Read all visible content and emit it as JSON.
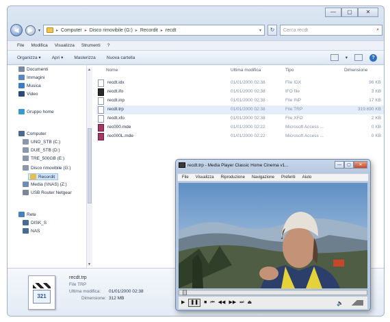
{
  "window": {
    "caps": {
      "min": "—",
      "max": "▢",
      "close": "✕"
    }
  },
  "address": {
    "crumbs": [
      "Computer",
      "Disco rimovibile (G:)",
      "Recordit",
      "recdt"
    ],
    "search_placeholder": "Cerca recdt"
  },
  "menu": [
    "File",
    "Modifica",
    "Visualizza",
    "Strumenti",
    "?"
  ],
  "toolbar": {
    "organize": "Organizza ▾",
    "open": "Apri ▾",
    "burn": "Masterizza",
    "new_folder": "Nuova cartella"
  },
  "nav": {
    "items": [
      {
        "label": "Documenti",
        "icon": "documents-icon",
        "color": "#7a8aa0"
      },
      {
        "label": "Immagini",
        "icon": "pictures-icon",
        "color": "#5b86c0"
      },
      {
        "label": "Musica",
        "icon": "music-icon",
        "color": "#3b7bc8"
      },
      {
        "label": "Video",
        "icon": "video-icon",
        "color": "#2a4a7a"
      },
      {
        "label": "Gruppo home",
        "icon": "homegroup-icon",
        "color": "#3a9ad0"
      },
      {
        "label": "Computer",
        "icon": "computer-icon",
        "color": "#4a6a96"
      },
      {
        "label": "UNO_STB (C:)",
        "icon": "drive-icon",
        "color": "#8a98aa"
      },
      {
        "label": "DUE_STB (D:)",
        "icon": "drive-icon",
        "color": "#8a98aa"
      },
      {
        "label": "TRE_500GB (E:)",
        "icon": "drive-icon",
        "color": "#8a98aa"
      },
      {
        "label": "Disco rimovibile (G:)",
        "icon": "usb-drive-icon",
        "color": "#8a98aa"
      },
      {
        "label": "Recordit",
        "icon": "folder-icon",
        "color": "#e5bf52"
      },
      {
        "label": "Media (\\\\NAS) (Z:)",
        "icon": "network-drive-icon",
        "color": "#6f8db2"
      },
      {
        "label": "USB Router Netgear",
        "icon": "router-icon",
        "color": "#7a8799"
      },
      {
        "label": "Rete",
        "icon": "network-icon",
        "color": "#4a7fbf"
      },
      {
        "label": "DISK_S",
        "icon": "network-computer-icon",
        "color": "#4a6a96"
      },
      {
        "label": "NAS",
        "icon": "network-computer-icon",
        "color": "#4a6a96"
      }
    ]
  },
  "columns": [
    "Nome",
    "Ultima modifica",
    "Tipo",
    "Dimensione"
  ],
  "files": [
    {
      "name": "recdt.idx",
      "date": "01/01/2000 02:38",
      "type": "File IDX",
      "size": "96 KB",
      "icon": "file-icon"
    },
    {
      "name": "recdt.ifo",
      "date": "01/01/2000 02:38",
      "type": "IFO file",
      "size": "3 KB",
      "icon": "ifo-file-icon"
    },
    {
      "name": "recdt.inp",
      "date": "01/01/2000 02:38",
      "type": "File INP",
      "size": "17 KB",
      "icon": "file-icon"
    },
    {
      "name": "recdt.trp",
      "date": "01/01/2000 02:38",
      "type": "File TRP",
      "size": "319.690 KB",
      "icon": "video-file-icon"
    },
    {
      "name": "recdt.xfo",
      "date": "01/01/2000 02:38",
      "type": "File XFO",
      "size": "2 KB",
      "icon": "file-icon"
    },
    {
      "name": "rec000.mde",
      "date": "01/01/2000 02:22",
      "type": "Microsoft Access ...",
      "size": "0 KB",
      "icon": "access-file-icon"
    },
    {
      "name": "rec000L.mde",
      "date": "01/01/2000 02:22",
      "type": "Microsoft Access ...",
      "size": "0 KB",
      "icon": "access-file-icon"
    }
  ],
  "details": {
    "name": "recdt.trp",
    "type": "File TRP",
    "modified_label": "Ultima modifica:",
    "modified": "01/01/2000 02:38",
    "size_label": "Dimensione:",
    "size": "312 MB",
    "icon_text": "321"
  },
  "player": {
    "title": "recdt.trp - Media Player Classic Home Cinema v1...",
    "menu": [
      "File",
      "Visualizza",
      "Riproduzione",
      "Navigazione",
      "Preferiti",
      "Aiuto"
    ],
    "controls": [
      "▶",
      "❚❚",
      "■",
      "⏮",
      "◀◀",
      "▶▶",
      "⏭",
      "⏏"
    ],
    "volume_icon": "🔈",
    "seek_fraction": 0.02
  }
}
